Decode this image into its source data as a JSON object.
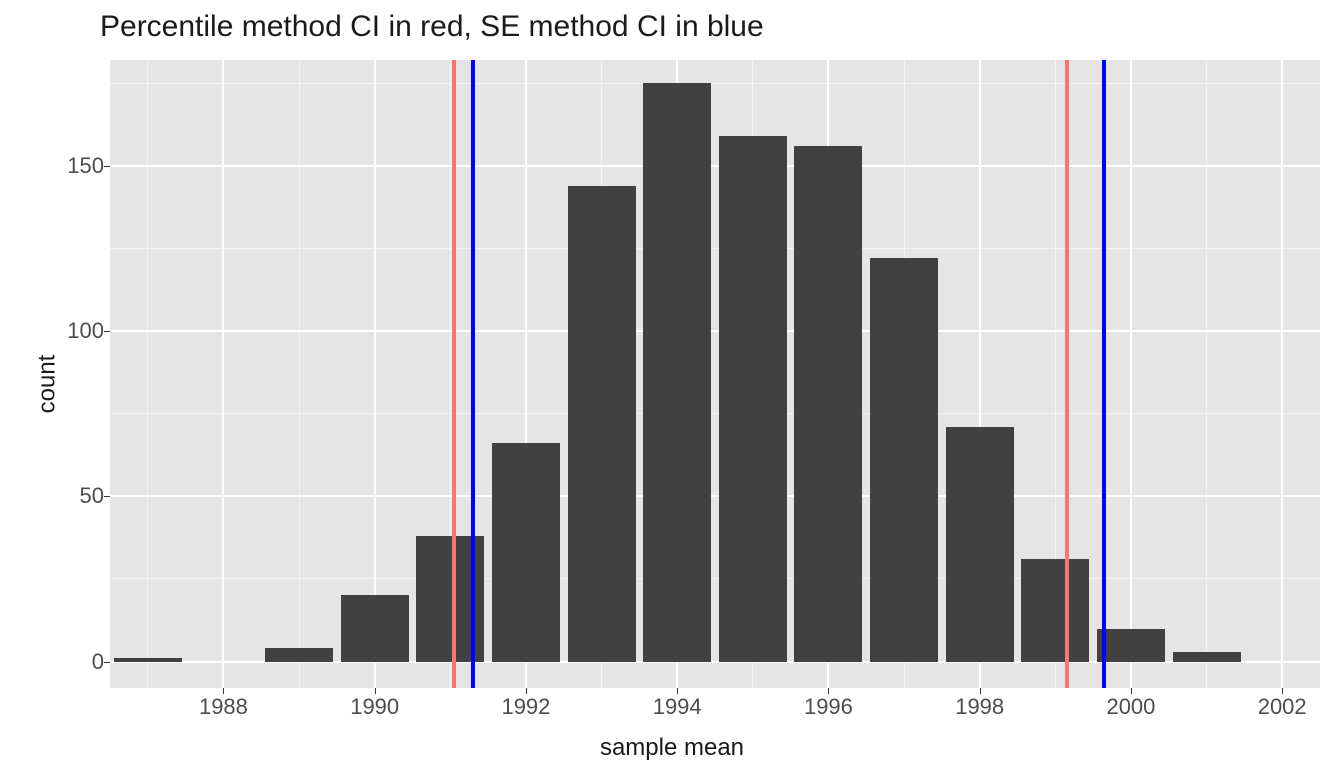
{
  "chart_data": {
    "type": "bar",
    "title": "Percentile method CI in red, SE method CI in blue",
    "xlabel": "sample mean",
    "ylabel": "count",
    "xlim": [
      1986.5,
      2002.5
    ],
    "ylim": [
      -8,
      182
    ],
    "x_ticks": [
      1988,
      1990,
      1992,
      1994,
      1996,
      1998,
      2000,
      2002
    ],
    "y_ticks": [
      0,
      50,
      100,
      150
    ],
    "x_minor": [
      1987,
      1989,
      1991,
      1993,
      1995,
      1997,
      1999,
      2001
    ],
    "y_minor": [
      25,
      75,
      125,
      175
    ],
    "bar_half_width": 0.45,
    "categories": [
      1987,
      1989,
      1990,
      1991,
      1992,
      1993,
      1994,
      1995,
      1996,
      1997,
      1998,
      1999,
      2000,
      2001
    ],
    "values": [
      1,
      4,
      20,
      38,
      66,
      144,
      175,
      159,
      156,
      122,
      71,
      31,
      10,
      3
    ],
    "vlines": [
      {
        "x": 1991.05,
        "color": "#F8766D",
        "width": 4
      },
      {
        "x": 1991.3,
        "color": "#0000FF",
        "width": 4
      },
      {
        "x": 1999.15,
        "color": "#F8766D",
        "width": 4
      },
      {
        "x": 1999.65,
        "color": "#0000FF",
        "width": 4
      }
    ],
    "colors": {
      "red": "#F8766D",
      "blue": "#0000FF",
      "bar": "#414142"
    }
  }
}
